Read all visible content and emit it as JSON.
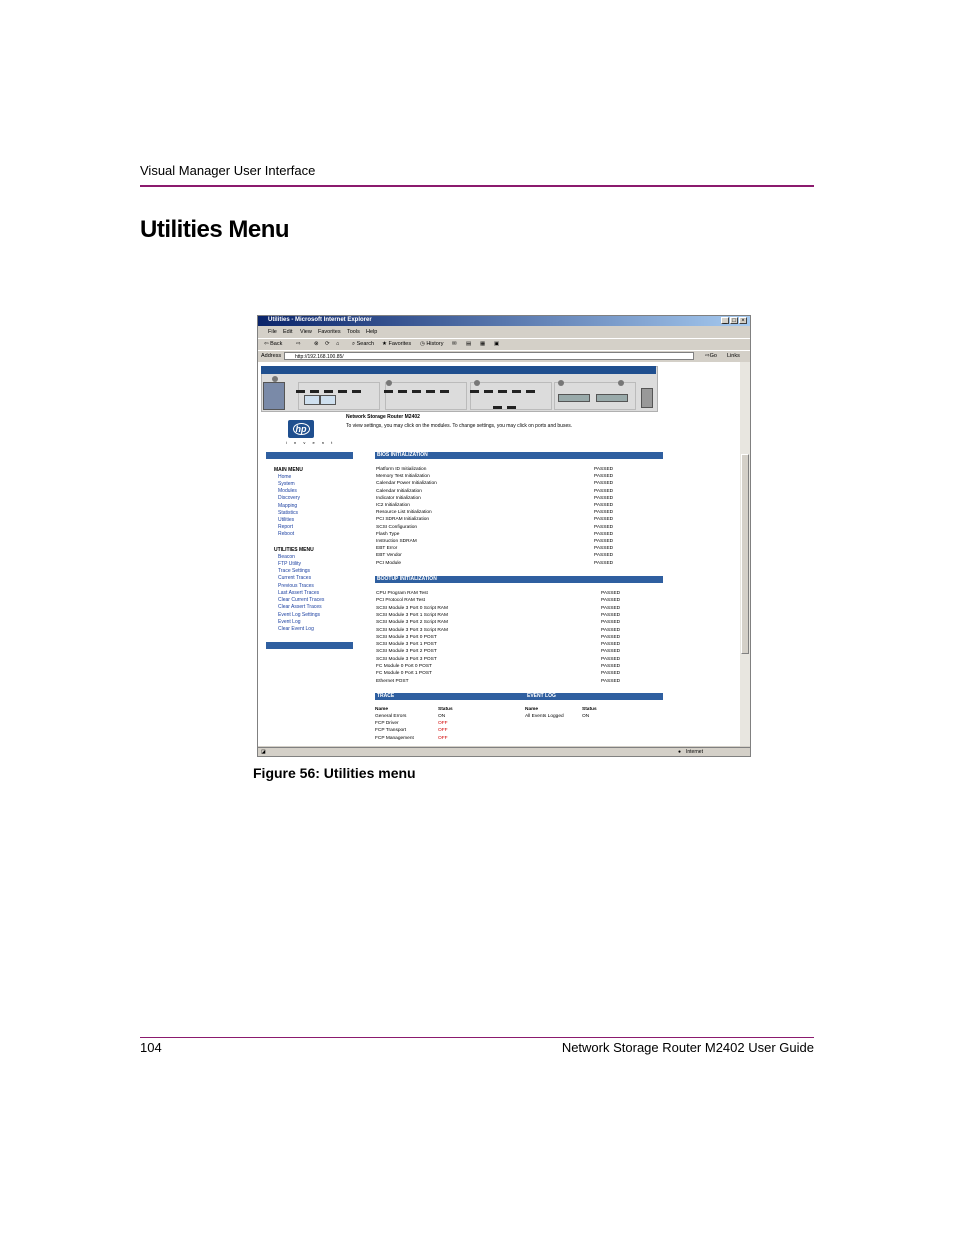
{
  "page": {
    "header": "Visual Manager User Interface",
    "title": "Utilities Menu",
    "caption": "Figure 56:  Utilities menu",
    "footer_page": "104",
    "footer_doc": "Network Storage Router M2402 User Guide",
    "accent_color": "#8b1a6e"
  },
  "browser": {
    "title": "Utilities - Microsoft Internet Explorer",
    "menu": [
      "File",
      "Edit",
      "View",
      "Favorites",
      "Tools",
      "Help"
    ],
    "toolbar": {
      "back": "Back",
      "search": "Search",
      "favorites": "Favorites",
      "history": "History"
    },
    "address_label": "Address",
    "address": "http://192.168.100.85/",
    "go": "Go",
    "links": "Links",
    "status_zone": "Internet"
  },
  "app": {
    "product": "Network Storage Router M2402",
    "instructions": "To view settings, you may click on the modules. To change settings, you may click on ports and buses.",
    "main_menu": {
      "heading": "MAIN MENU",
      "items": [
        "Home",
        "System",
        "Modules",
        "Discovery",
        "Mapping",
        "Statistics",
        "Utilities",
        "Report",
        "Reboot"
      ]
    },
    "utilities_menu": {
      "heading": "UTILITIES MENU",
      "items": [
        "Beacon",
        "FTP Utility",
        "Trace Settings",
        "Current Traces",
        "Previous Traces",
        "Last Assert Traces",
        "Clear Current Traces",
        "Clear Assert Traces",
        "Event Log Settings",
        "Event Log",
        "Clear Event Log"
      ]
    },
    "bios": {
      "heading": "BIOS INITIALIZATION",
      "rows": [
        [
          "Platform ID Initialization",
          "PASSED"
        ],
        [
          "Memory Test Initialization",
          "PASSED"
        ],
        [
          "Calendar Power Initialization",
          "PASSED"
        ],
        [
          "Calendar Initialization",
          "PASSED"
        ],
        [
          "Indicator Initialization",
          "PASSED"
        ],
        [
          "IC2 Initialization",
          "PASSED"
        ],
        [
          "Resource List Initialization",
          "PASSED"
        ],
        [
          "PCI SDRAM Initialization",
          "PASSED"
        ],
        [
          "SCSI Configuration",
          "PASSED"
        ],
        [
          "Flash Type",
          "PASSED"
        ],
        [
          "Instruction SDRAM",
          "PASSED"
        ],
        [
          "EBT Error",
          "PASSED"
        ],
        [
          "EBT Vendor",
          "PASSED"
        ],
        [
          "PCI Module",
          "PASSED"
        ]
      ]
    },
    "bootup": {
      "heading": "BOOTUP INITIALIZATION",
      "rows": [
        [
          "CPU Program RAM Test",
          "PASSED"
        ],
        [
          "PCI Protocol RAM Test",
          "PASSED"
        ],
        [
          "SCSI Module 3 Port 0 Script RAM",
          "PASSED"
        ],
        [
          "SCSI Module 3 Port 1 Script RAM",
          "PASSED"
        ],
        [
          "SCSI Module 3 Port 2 Script RAM",
          "PASSED"
        ],
        [
          "SCSI Module 3 Port 3 Script RAM",
          "PASSED"
        ],
        [
          "SCSI Module 3 Port 0 POST",
          "PASSED"
        ],
        [
          "SCSI Module 3 Port 1 POST",
          "PASSED"
        ],
        [
          "SCSI Module 3 Port 2 POST",
          "PASSED"
        ],
        [
          "SCSI Module 3 Port 3 POST",
          "PASSED"
        ],
        [
          "FC Module 0 Port 0 POST",
          "PASSED"
        ],
        [
          "FC Module 0 Port 1 POST",
          "PASSED"
        ],
        [
          "Ethernet POST",
          "PASSED"
        ]
      ]
    },
    "trace": {
      "heading": "TRACE",
      "col_name": "Name",
      "col_status": "Status",
      "rows": [
        [
          "General Errors",
          "ON"
        ],
        [
          "FCP Driver",
          "OFF"
        ],
        [
          "FCP Transport",
          "OFF"
        ],
        [
          "FCP Management",
          "OFF"
        ]
      ]
    },
    "event_log": {
      "heading": "EVENT LOG",
      "col_name": "Name",
      "col_status": "Status",
      "rows": [
        [
          "All Events Logged",
          "ON"
        ]
      ]
    }
  }
}
